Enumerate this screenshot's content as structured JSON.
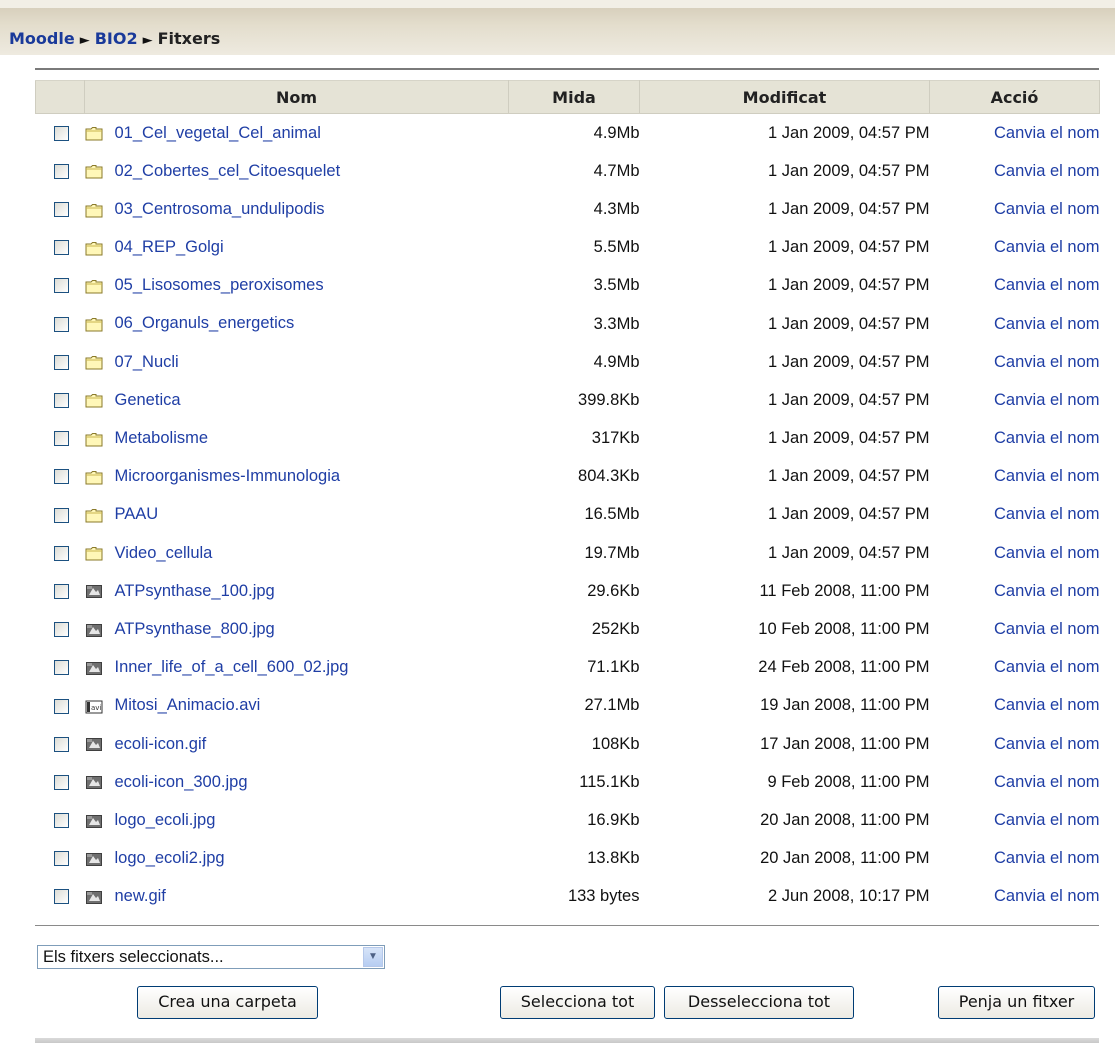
{
  "breadcrumb": {
    "items": [
      "Moodle",
      "BIO2",
      "Fitxers"
    ]
  },
  "table": {
    "headers": {
      "name": "Nom",
      "size": "Mida",
      "modified": "Modificat",
      "action": "Acció"
    },
    "rows": [
      {
        "icon": "folder-icon",
        "name": "01_Cel_vegetal_Cel_animal",
        "size": "4.9Mb",
        "modified": "1 Jan 2009, 04:57 PM",
        "action": "Canvia el nom"
      },
      {
        "icon": "folder-icon",
        "name": "02_Cobertes_cel_Citoesquelet",
        "size": "4.7Mb",
        "modified": "1 Jan 2009, 04:57 PM",
        "action": "Canvia el nom"
      },
      {
        "icon": "folder-icon",
        "name": "03_Centrosoma_undulipodis",
        "size": "4.3Mb",
        "modified": "1 Jan 2009, 04:57 PM",
        "action": "Canvia el nom"
      },
      {
        "icon": "folder-icon",
        "name": "04_REP_Golgi",
        "size": "5.5Mb",
        "modified": "1 Jan 2009, 04:57 PM",
        "action": "Canvia el nom"
      },
      {
        "icon": "folder-icon",
        "name": "05_Lisosomes_peroxisomes",
        "size": "3.5Mb",
        "modified": "1 Jan 2009, 04:57 PM",
        "action": "Canvia el nom"
      },
      {
        "icon": "folder-icon",
        "name": "06_Organuls_energetics",
        "size": "3.3Mb",
        "modified": "1 Jan 2009, 04:57 PM",
        "action": "Canvia el nom"
      },
      {
        "icon": "folder-icon",
        "name": "07_Nucli",
        "size": "4.9Mb",
        "modified": "1 Jan 2009, 04:57 PM",
        "action": "Canvia el nom"
      },
      {
        "icon": "folder-icon",
        "name": "Genetica",
        "size": "399.8Kb",
        "modified": "1 Jan 2009, 04:57 PM",
        "action": "Canvia el nom"
      },
      {
        "icon": "folder-icon",
        "name": "Metabolisme",
        "size": "317Kb",
        "modified": "1 Jan 2009, 04:57 PM",
        "action": "Canvia el nom"
      },
      {
        "icon": "folder-icon",
        "name": "Microorganismes-Immunologia",
        "size": "804.3Kb",
        "modified": "1 Jan 2009, 04:57 PM",
        "action": "Canvia el nom"
      },
      {
        "icon": "folder-icon",
        "name": "PAAU",
        "size": "16.5Mb",
        "modified": "1 Jan 2009, 04:57 PM",
        "action": "Canvia el nom"
      },
      {
        "icon": "folder-icon",
        "name": "Video_cellula",
        "size": "19.7Mb",
        "modified": "1 Jan 2009, 04:57 PM",
        "action": "Canvia el nom"
      },
      {
        "icon": "image-file-icon",
        "name": "ATPsynthase_100.jpg",
        "size": "29.6Kb",
        "modified": "11 Feb 2008, 11:00 PM",
        "action": "Canvia el nom"
      },
      {
        "icon": "image-file-icon",
        "name": "ATPsynthase_800.jpg",
        "size": "252Kb",
        "modified": "10 Feb 2008, 11:00 PM",
        "action": "Canvia el nom"
      },
      {
        "icon": "image-file-icon",
        "name": "Inner_life_of_a_cell_600_02.jpg",
        "size": "71.1Kb",
        "modified": "24 Feb 2008, 11:00 PM",
        "action": "Canvia el nom"
      },
      {
        "icon": "video-file-icon",
        "name": "Mitosi_Animacio.avi",
        "size": "27.1Mb",
        "modified": "19 Jan 2008, 11:00 PM",
        "action": "Canvia el nom"
      },
      {
        "icon": "image-file-icon",
        "name": "ecoli-icon.gif",
        "size": "108Kb",
        "modified": "17 Jan 2008, 11:00 PM",
        "action": "Canvia el nom"
      },
      {
        "icon": "image-file-icon",
        "name": "ecoli-icon_300.jpg",
        "size": "115.1Kb",
        "modified": "9 Feb 2008, 11:00 PM",
        "action": "Canvia el nom"
      },
      {
        "icon": "image-file-icon",
        "name": "logo_ecoli.jpg",
        "size": "16.9Kb",
        "modified": "20 Jan 2008, 11:00 PM",
        "action": "Canvia el nom"
      },
      {
        "icon": "image-file-icon",
        "name": "logo_ecoli2.jpg",
        "size": "13.8Kb",
        "modified": "20 Jan 2008, 11:00 PM",
        "action": "Canvia el nom"
      },
      {
        "icon": "image-file-icon",
        "name": "new.gif",
        "size": "133 bytes",
        "modified": "2 Jun 2008, 10:17 PM",
        "action": "Canvia el nom"
      }
    ]
  },
  "controls": {
    "selected_action": "Els fitxers seleccionats...",
    "create_folder": "Crea una carpeta",
    "select_all": "Selecciona tot",
    "deselect_all": "Desselecciona tot",
    "upload": "Penja un fitxer"
  },
  "colors": {
    "link": "#1f3ea5",
    "header_bg": "#e5e3d6",
    "navbar": "#e3ddcc"
  }
}
